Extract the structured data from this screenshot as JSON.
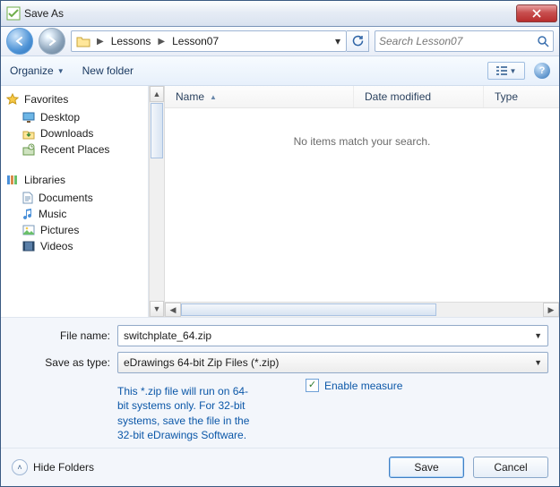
{
  "title": "Save As",
  "breadcrumbs": [
    "Lessons",
    "Lesson07"
  ],
  "search_placeholder": "Search Lesson07",
  "toolbar": {
    "organize": "Organize",
    "newfolder": "New folder"
  },
  "tree": {
    "favorites": {
      "title": "Favorites",
      "items": [
        "Desktop",
        "Downloads",
        "Recent Places"
      ]
    },
    "libraries": {
      "title": "Libraries",
      "items": [
        "Documents",
        "Music",
        "Pictures",
        "Videos"
      ]
    }
  },
  "columns": {
    "name": "Name",
    "date": "Date modified",
    "type": "Type"
  },
  "empty_message": "No items match your search.",
  "filename_label": "File name:",
  "filename_value": "switchplate_64.zip",
  "savetype_label": "Save as type:",
  "savetype_value": "eDrawings 64-bit Zip Files (*.zip)",
  "note_text": "This *.zip file will run on 64-bit systems only. For 32-bit systems, save the file in the 32-bit eDrawings Software.",
  "enable_measure": "Enable measure",
  "hide_folders": "Hide Folders",
  "save_btn": "Save",
  "cancel_btn": "Cancel"
}
